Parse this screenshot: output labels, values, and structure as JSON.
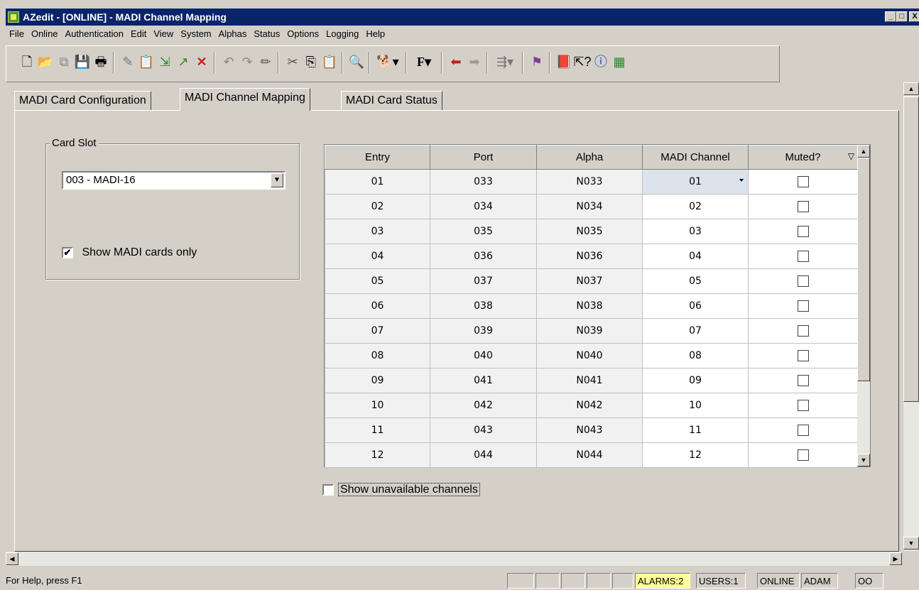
{
  "window": {
    "title": "AZedit - [ONLINE] - MADI Channel Mapping",
    "min": "_",
    "max": "□",
    "close": "X"
  },
  "menus": [
    "File",
    "Online",
    "Authentication",
    "Edit",
    "View",
    "System",
    "Alphas",
    "Status",
    "Options",
    "Logging",
    "Help"
  ],
  "toolbar_icons": [
    "new-icon",
    "open-icon",
    "copy-icon",
    "save-icon",
    "print-icon",
    "wrench-icon",
    "paste-icon",
    "download-icon",
    "upload-icon",
    "delete-icon",
    "undo-icon",
    "redo-icon",
    "pencil-icon",
    "cut-icon",
    "copy2-icon",
    "paste2-icon",
    "find-icon",
    "dog-icon",
    "font-icon",
    "left-arrow-icon",
    "right-arrow-icon",
    "usb-icon",
    "flag-icon",
    "book-icon",
    "help-cursor-icon",
    "info-icon",
    "grid-icon"
  ],
  "tabs": [
    "MADI Card Configuration",
    "MADI Channel Mapping",
    "MADI Card Status"
  ],
  "card_slot": {
    "legend": "Card Slot",
    "selected": "003 - MADI-16",
    "show_madi_only_label": "Show MADI cards only",
    "show_madi_only_checked": "✔"
  },
  "grid": {
    "headers": [
      "Entry",
      "Port",
      "Alpha",
      "MADI Channel",
      "Muted?"
    ],
    "sort_glyph": "▽",
    "rows": [
      [
        "01",
        "033",
        "N033",
        "01"
      ],
      [
        "02",
        "034",
        "N034",
        "02"
      ],
      [
        "03",
        "035",
        "N035",
        "03"
      ],
      [
        "04",
        "036",
        "N036",
        "04"
      ],
      [
        "05",
        "037",
        "N037",
        "05"
      ],
      [
        "06",
        "038",
        "N038",
        "06"
      ],
      [
        "07",
        "039",
        "N039",
        "07"
      ],
      [
        "08",
        "040",
        "N040",
        "08"
      ],
      [
        "09",
        "041",
        "N041",
        "09"
      ],
      [
        "10",
        "042",
        "N042",
        "10"
      ],
      [
        "11",
        "043",
        "N043",
        "11"
      ],
      [
        "12",
        "044",
        "N044",
        "12"
      ]
    ]
  },
  "show_unavailable_label": "Show unavailable channels",
  "status": {
    "help": "For Help, press F1",
    "alarms": "ALARMS:2",
    "users": "USERS:1",
    "online": "ONLINE",
    "user": "ADAM",
    "net": "OO"
  },
  "colors": {
    "titlebar": "#0a246a",
    "alarm_bg": "#ffff99",
    "face": "#d4d0c8"
  }
}
